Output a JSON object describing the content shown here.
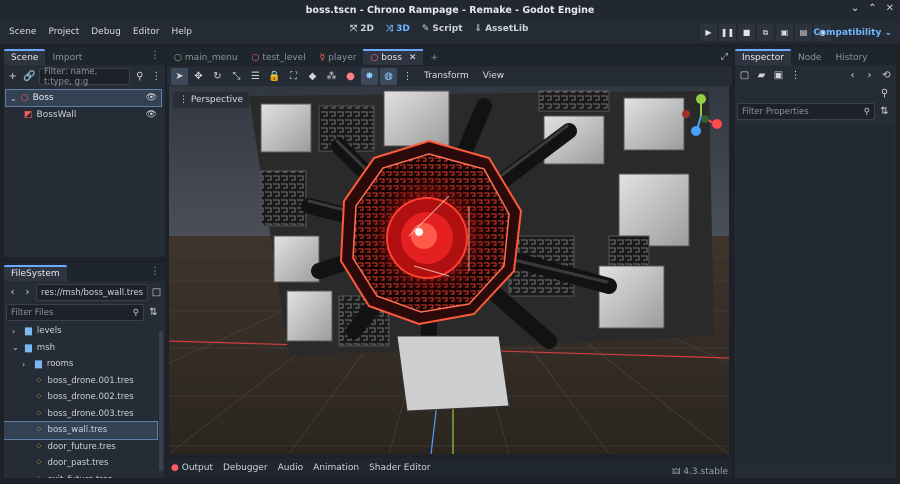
{
  "window": {
    "title": "boss.tscn - Chrono Rampage - Remake - Godot Engine"
  },
  "menu": [
    "Scene",
    "Project",
    "Debug",
    "Editor",
    "Help"
  ],
  "modes": {
    "m2d": "2D",
    "m3d": "3D",
    "script": "Script",
    "assetlib": "AssetLib"
  },
  "renderer": "Compatibility",
  "scene_panel": {
    "tabs": [
      "Scene",
      "Import"
    ],
    "filter_placeholder": "Filter: name, t:type, g:g",
    "nodes": [
      {
        "label": "Boss",
        "color": "#ff5d5d"
      },
      {
        "label": "BossWall",
        "color": "#ff5d5d"
      }
    ]
  },
  "filesystem": {
    "tab": "FileSystem",
    "path": "res://msh/boss_wall.tres",
    "filter_placeholder": "Filter Files",
    "items": [
      {
        "label": "levels",
        "type": "folder",
        "indent": 1
      },
      {
        "label": "msh",
        "type": "folder-open",
        "indent": 1
      },
      {
        "label": "rooms",
        "type": "folder",
        "indent": 2
      },
      {
        "label": "boss_drone.001.tres",
        "type": "res",
        "indent": 2
      },
      {
        "label": "boss_drone.002.tres",
        "type": "res",
        "indent": 2
      },
      {
        "label": "boss_drone.003.tres",
        "type": "res",
        "indent": 2
      },
      {
        "label": "boss_wall.tres",
        "type": "res",
        "indent": 2,
        "selected": true
      },
      {
        "label": "door_future.tres",
        "type": "res",
        "indent": 2
      },
      {
        "label": "door_past.tres",
        "type": "res",
        "indent": 2
      },
      {
        "label": "exit_future.tres",
        "type": "res",
        "indent": 2
      }
    ]
  },
  "editor_tabs": [
    {
      "label": "main_menu",
      "icon": "#6fd07a"
    },
    {
      "label": "test_level",
      "icon": "#ff6666"
    },
    {
      "label": "player",
      "icon": "#ff6666"
    },
    {
      "label": "boss",
      "icon": "#ff6666",
      "active": true
    }
  ],
  "viewport_toolbar": {
    "transform": "Transform",
    "view": "View"
  },
  "viewport": {
    "perspective_label": "Perspective"
  },
  "inspector": {
    "tabs": [
      "Inspector",
      "Node",
      "History"
    ],
    "filter_placeholder": "Filter Properties"
  },
  "bottom": {
    "tabs": [
      "Output",
      "Debugger",
      "Audio",
      "Animation",
      "Shader Editor"
    ],
    "version": "4.3.stable"
  },
  "colors": {
    "accent": "#6aa9ff",
    "node3d": "#ff5d5d"
  }
}
